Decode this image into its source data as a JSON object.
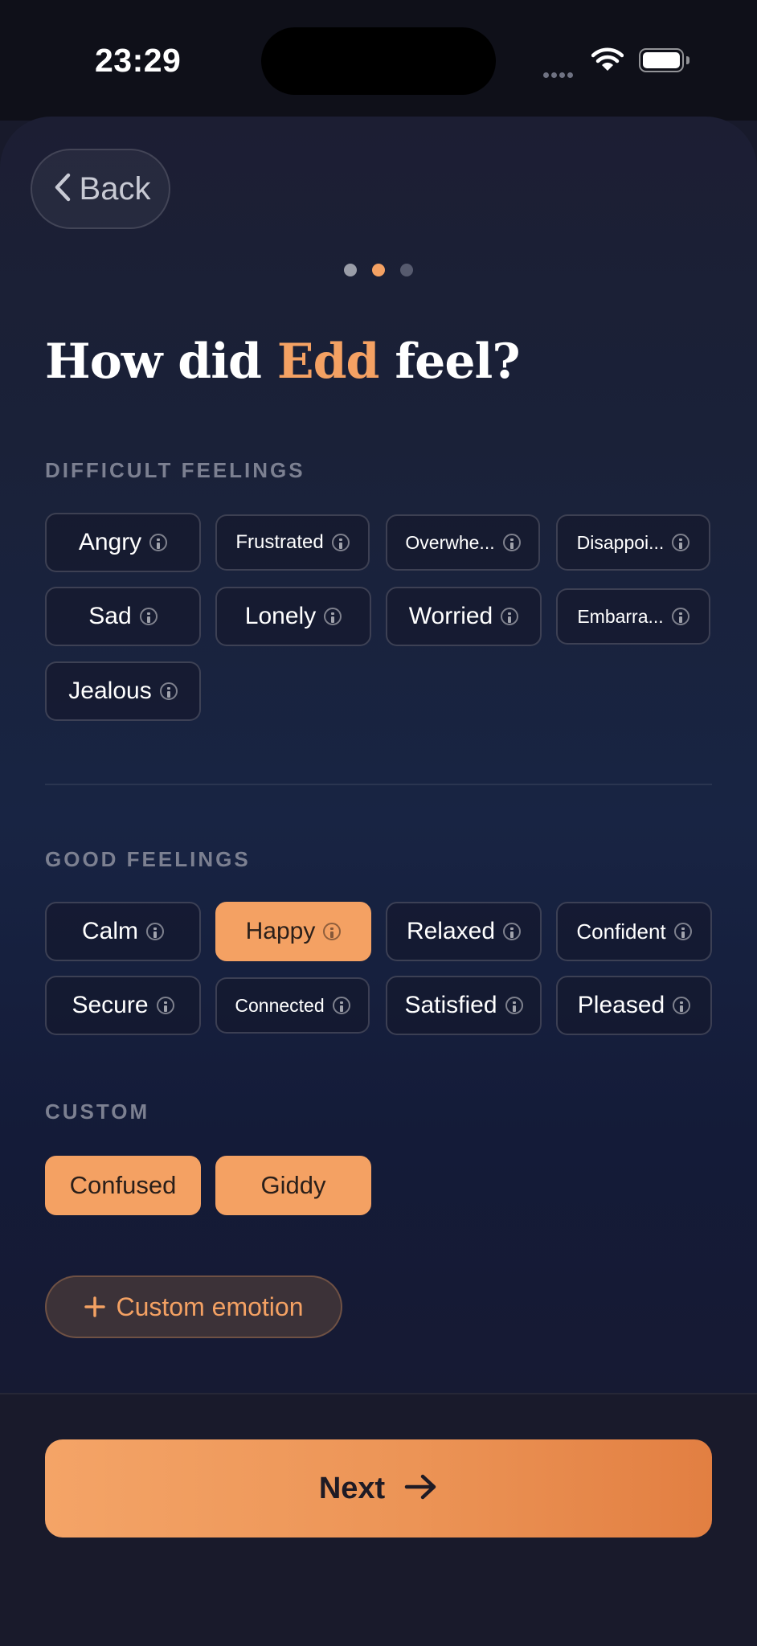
{
  "status_bar": {
    "time": "23:29"
  },
  "header": {
    "back_label": "Back"
  },
  "progress": {
    "current_step": 2,
    "total_steps": 3
  },
  "headline": {
    "prefix": "How did ",
    "name": "Edd",
    "suffix": " feel?"
  },
  "difficult": {
    "label": "DIFFICULT FEELINGS",
    "chips": [
      "Angry",
      "Frustrated",
      "Overwhe...",
      "Disappoi...",
      "Sad",
      "Lonely",
      "Worried",
      "Embarra...",
      "Jealous"
    ]
  },
  "good": {
    "label": "GOOD FEELINGS",
    "chips": [
      "Calm",
      "Happy",
      "Relaxed",
      "Confident",
      "Secure",
      "Connected",
      "Satisfied",
      "Pleased"
    ],
    "selected": "Happy"
  },
  "custom": {
    "label": "CUSTOM",
    "chips": [
      "Confused",
      "Giddy"
    ],
    "add_label": "Custom emotion"
  },
  "footer": {
    "next_label": "Next"
  },
  "colors": {
    "accent": "#f4a163",
    "background": "#181a2b"
  }
}
